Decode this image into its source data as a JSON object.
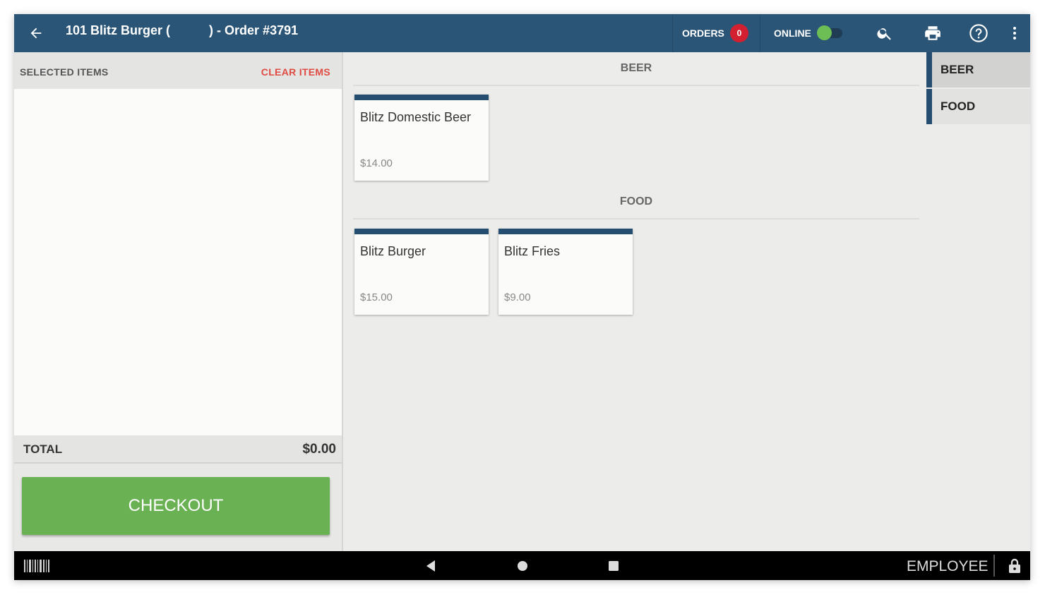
{
  "header": {
    "title": "101 Blitz Burger (           ) - Order #3791",
    "orders_label": "ORDERS",
    "orders_count": "0",
    "online_label": "ONLINE",
    "online_on": true,
    "icons": [
      "back-arrow-icon",
      "search-icon",
      "printer-icon",
      "help-icon",
      "more-vert-icon"
    ]
  },
  "order_panel": {
    "selected_label": "SELECTED ITEMS",
    "clear_label": "CLEAR ITEMS",
    "items": [],
    "total_label": "TOTAL",
    "total_value": "$0.00",
    "checkout_label": "CHECKOUT"
  },
  "menu": {
    "sections": [
      {
        "name": "BEER",
        "items": [
          {
            "name": "Blitz Domestic Beer",
            "price": "$14.00"
          }
        ]
      },
      {
        "name": "FOOD",
        "items": [
          {
            "name": "Blitz Burger",
            "price": "$15.00"
          },
          {
            "name": "Blitz Fries",
            "price": "$9.00"
          }
        ]
      }
    ]
  },
  "categories": {
    "tabs": [
      {
        "label": "BEER",
        "selected": true
      },
      {
        "label": "FOOD",
        "selected": false
      }
    ]
  },
  "footer": {
    "employee_label": "EMPLOYEE",
    "icons": [
      "barcode-icon",
      "nav-back-icon",
      "nav-home-icon",
      "nav-recents-icon",
      "lock-icon"
    ]
  },
  "colors": {
    "header_bg": "#2b5576",
    "accent": "#244d70",
    "checkout_green": "#6ab153",
    "clear_red": "#e04b43",
    "badge_red": "#d32030",
    "online_green": "#6dbf55"
  }
}
